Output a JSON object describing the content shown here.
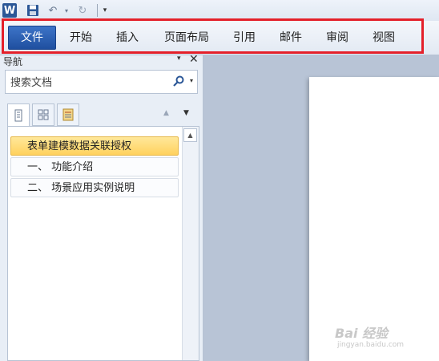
{
  "app": {
    "logo_letter": "W"
  },
  "quick_access": {
    "undo_icon": "↶",
    "redo_icon": "↻",
    "dropdown_icon": "▾",
    "customize_icon": "▾"
  },
  "ribbon": {
    "tabs": [
      {
        "label": "文件"
      },
      {
        "label": "开始"
      },
      {
        "label": "插入"
      },
      {
        "label": "页面布局"
      },
      {
        "label": "引用"
      },
      {
        "label": "邮件"
      },
      {
        "label": "审阅"
      },
      {
        "label": "视图"
      }
    ],
    "highlight_color": "#e4202a",
    "file_tab_color": "#2b5797"
  },
  "navigation_pane": {
    "title": "导航",
    "dropdown_icon": "▾",
    "close_icon": "✕",
    "search": {
      "placeholder": "搜索文档"
    },
    "view_tabs": [
      "headings-view-icon",
      "pages-view-icon",
      "results-view-icon"
    ],
    "up_icon": "▲",
    "down_icon": "▼",
    "headings": [
      {
        "label": "表单建模数据关联授权",
        "selected": true
      },
      {
        "label": "一、 功能介绍"
      },
      {
        "label": "二、 场景应用实例说明"
      }
    ],
    "scroll_up_icon": "▲",
    "selected_color": "#ffd15e"
  },
  "watermark": {
    "text": "Bai 经验",
    "sub": "jingyan.baidu.com"
  }
}
